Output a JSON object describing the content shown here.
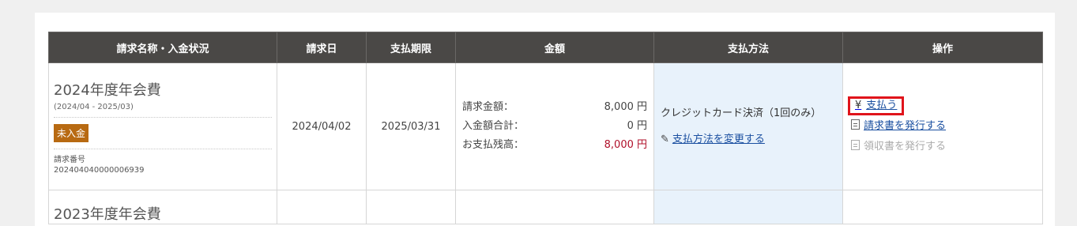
{
  "table": {
    "headers": [
      "請求名称・入金状況",
      "請求日",
      "支払期限",
      "金額",
      "支払方法",
      "操作"
    ],
    "rows": [
      {
        "title": "2024年度年会費",
        "period": "(2024/04 - 2025/03)",
        "status": "未入金",
        "invoice_no_label": "請求番号",
        "invoice_no": "202404040000006939",
        "invoice_date": "2024/04/02",
        "due_date": "2025/03/31",
        "amounts": [
          {
            "label": "請求金額：",
            "value": "8,000 円"
          },
          {
            "label": "入金額合計：",
            "value": "0 円"
          },
          {
            "label": "お支払残高：",
            "value": "8,000 円"
          }
        ],
        "payment_method": "クレジットカード決済（1回のみ）",
        "change_payment": "支払方法を変更する",
        "ops": {
          "pay_icon": "¥",
          "pay": "支払う",
          "issue_invoice": "請求書を発行する",
          "issue_receipt": "領収書を発行する"
        }
      },
      {
        "title": "2023年度年会費"
      }
    ]
  },
  "colors": {
    "header_bg": "#4a4846",
    "badge_bg": "#b86a12",
    "payment_bg": "#e8f2fb",
    "link": "#1a4fa0",
    "balance": "#b0102a",
    "highlight_border": "#e0141b"
  }
}
